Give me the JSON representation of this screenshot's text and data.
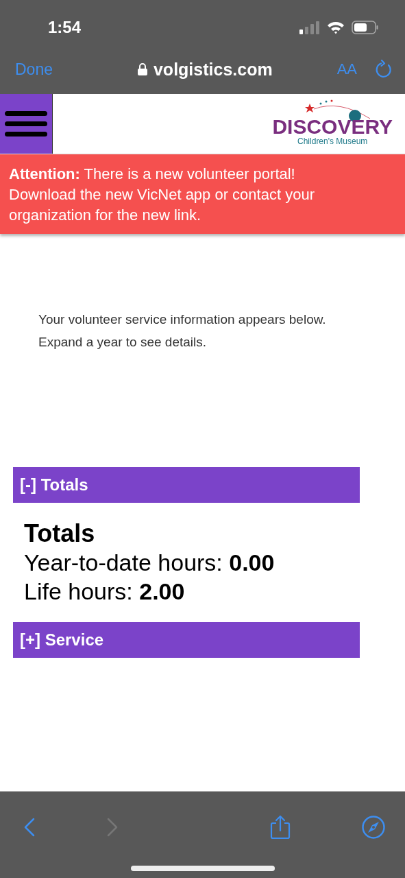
{
  "status_bar": {
    "time": "1:54"
  },
  "browser_bar": {
    "done": "Done",
    "url": "volgistics.com",
    "text_size": "AA"
  },
  "header": {
    "brand": "DISCOVERY",
    "subtitle": "Children's Museum"
  },
  "banner": {
    "text": "**Attention:** There is a new volunteer portal! Download the new VicNet app or contact your organization for the new link."
  },
  "intro": [
    "Your volunteer service information appears below.",
    "Expand a year to see details."
  ],
  "sections": [
    {
      "label": "[-] Totals",
      "title": "Totals",
      "rows": [
        {
          "label": "Year-to-date hours:",
          "value": "0.00"
        },
        {
          "label": "Life hours:",
          "value": "2.00"
        }
      ]
    },
    {
      "label": "[+] Service"
    }
  ],
  "toolbar": {
    "back_disabled": false,
    "forward_disabled": true
  }
}
